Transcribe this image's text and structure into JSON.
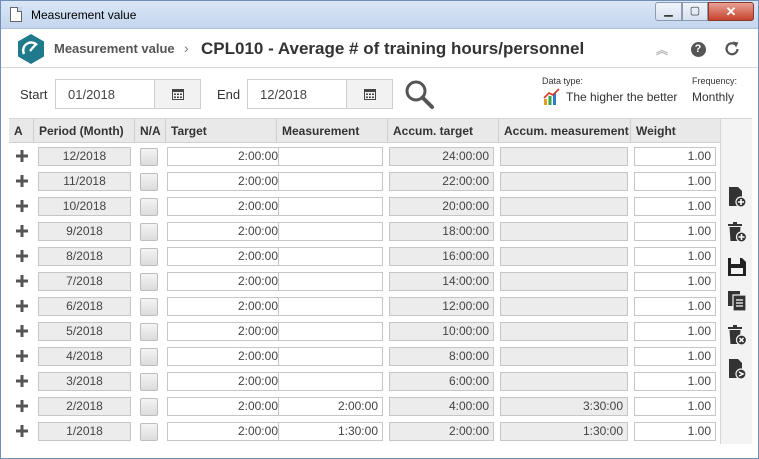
{
  "window": {
    "title": "Measurement value"
  },
  "header": {
    "breadcrumb": "Measurement value",
    "title": "CPL010 - Average # of training hours/personnel"
  },
  "filters": {
    "start_label": "Start",
    "start_value": "01/2018",
    "end_label": "End",
    "end_value": "12/2018",
    "data_type_label": "Data type:",
    "data_type_value": "The higher the better",
    "frequency_label": "Frequency:",
    "frequency_value": "Monthly"
  },
  "table": {
    "columns": [
      "A",
      "Period (Month)",
      "N/A",
      "Target",
      "Measurement",
      "Accum. target",
      "Accum. measurement",
      "Weight"
    ],
    "rows": [
      {
        "period": "12/2018",
        "target": "2:00:00",
        "measurement": "",
        "accum_target": "24:00:00",
        "accum_measurement": "",
        "weight": "1.00"
      },
      {
        "period": "11/2018",
        "target": "2:00:00",
        "measurement": "",
        "accum_target": "22:00:00",
        "accum_measurement": "",
        "weight": "1.00"
      },
      {
        "period": "10/2018",
        "target": "2:00:00",
        "measurement": "",
        "accum_target": "20:00:00",
        "accum_measurement": "",
        "weight": "1.00"
      },
      {
        "period": "9/2018",
        "target": "2:00:00",
        "measurement": "",
        "accum_target": "18:00:00",
        "accum_measurement": "",
        "weight": "1.00"
      },
      {
        "period": "8/2018",
        "target": "2:00:00",
        "measurement": "",
        "accum_target": "16:00:00",
        "accum_measurement": "",
        "weight": "1.00"
      },
      {
        "period": "7/2018",
        "target": "2:00:00",
        "measurement": "",
        "accum_target": "14:00:00",
        "accum_measurement": "",
        "weight": "1.00"
      },
      {
        "period": "6/2018",
        "target": "2:00:00",
        "measurement": "",
        "accum_target": "12:00:00",
        "accum_measurement": "",
        "weight": "1.00"
      },
      {
        "period": "5/2018",
        "target": "2:00:00",
        "measurement": "",
        "accum_target": "10:00:00",
        "accum_measurement": "",
        "weight": "1.00"
      },
      {
        "period": "4/2018",
        "target": "2:00:00",
        "measurement": "",
        "accum_target": "8:00:00",
        "accum_measurement": "",
        "weight": "1.00"
      },
      {
        "period": "3/2018",
        "target": "2:00:00",
        "measurement": "",
        "accum_target": "6:00:00",
        "accum_measurement": "",
        "weight": "1.00"
      },
      {
        "period": "2/2018",
        "target": "2:00:00",
        "measurement": "2:00:00",
        "accum_target": "4:00:00",
        "accum_measurement": "3:30:00",
        "weight": "1.00"
      },
      {
        "period": "1/2018",
        "target": "2:00:00",
        "measurement": "1:30:00",
        "accum_target": "2:00:00",
        "accum_measurement": "1:30:00",
        "weight": "1.00"
      }
    ]
  },
  "colors": {
    "accent": "#1f7a8c",
    "window_border": "#6f8fb8",
    "close": "#c7422c"
  },
  "icons": {
    "app": "gauge-icon",
    "refresh": "refresh-icon",
    "help": "help-icon",
    "side": [
      "new-document-icon",
      "delete-icon",
      "save-icon",
      "copy-icon",
      "delete-all-icon",
      "export-document-icon"
    ]
  }
}
